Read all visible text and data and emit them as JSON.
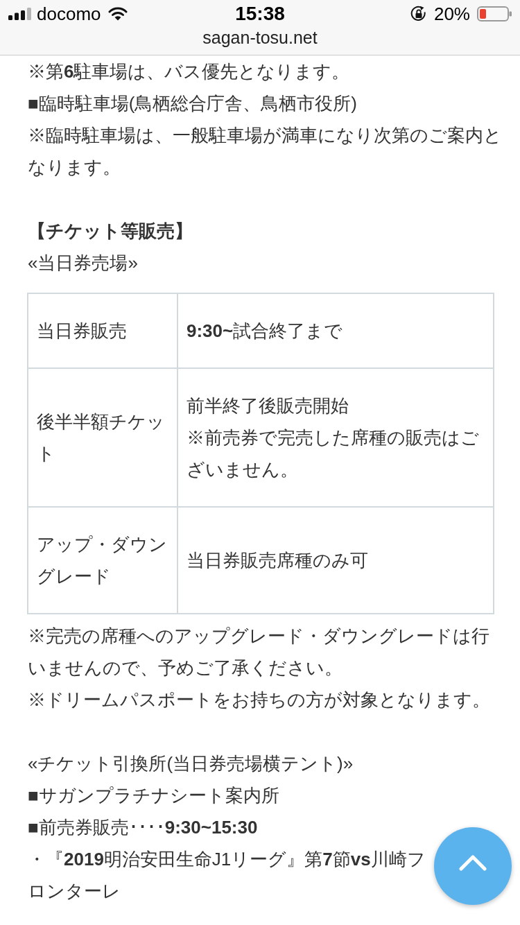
{
  "status_bar": {
    "carrier": "docomo",
    "time": "15:38",
    "battery": "20%"
  },
  "address_bar": {
    "url": "sagan-tosu.net"
  },
  "article": {
    "sections": [
      {
        "blocks": [
          {
            "kind": "paragraph",
            "text": "※第**6**駐車場は、バス優先となります。"
          },
          {
            "kind": "paragraph",
            "text": "■臨時駐車場(鳥栖総合庁舎、鳥栖市役所)"
          },
          {
            "kind": "paragraph",
            "text": "※臨時駐車場は、一般駐車場が満車になり次第のご案内となります。"
          }
        ]
      },
      {
        "blocks": [
          {
            "kind": "heading",
            "text": "【チケット等販売】"
          },
          {
            "kind": "paragraph",
            "text": "«当日券売場»"
          },
          {
            "kind": "table",
            "rows": [
              {
                "label": "当日券販売",
                "value": [
                  "**9:30~**試合終了まで"
                ]
              },
              {
                "label": "後半半額チケット",
                "value": [
                  "前半終了後販売開始",
                  "※前売券で完売した席種の販売はございません。"
                ]
              },
              {
                "label": "アップ・ダウングレード",
                "value": [
                  "当日券販売席種のみ可"
                ]
              }
            ]
          },
          {
            "kind": "paragraph",
            "text": "※完売の席種へのアップグレード・ダウングレードは行いませんので、予めご了承ください。"
          },
          {
            "kind": "paragraph",
            "text": "※ドリームパスポートをお持ちの方が対象となります。"
          }
        ]
      },
      {
        "blocks": [
          {
            "kind": "paragraph",
            "text": "«チケット引換所(当日券売場横テント)»"
          },
          {
            "kind": "paragraph",
            "text": "■サガンプラチナシート案内所"
          },
          {
            "kind": "paragraph",
            "text": "■前売券販売････**9:30~15:30**"
          },
          {
            "kind": "paragraph",
            "text": "・『**2019**明治安田生命J1リーグ』第**7**節**vs**川崎フロンターレ"
          }
        ]
      }
    ]
  }
}
